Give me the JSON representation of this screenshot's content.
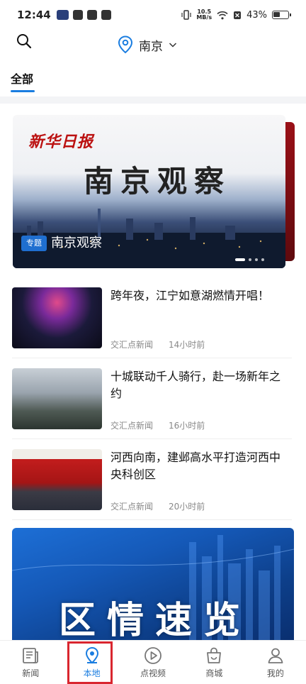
{
  "status_bar": {
    "time": "12:44",
    "net_speed_value": "10.5",
    "net_speed_unit": "MB/s",
    "battery": "43%"
  },
  "header": {
    "city": "南京"
  },
  "tabs": {
    "all": "全部"
  },
  "banner": {
    "logo_text": "新华日报",
    "big_title": "南京观察",
    "tag": "专题",
    "caption": "南京观察"
  },
  "news": [
    {
      "title": "跨年夜，江宁如意湖燃情开唱！",
      "source": "交汇点新闻",
      "time": "14小时前"
    },
    {
      "title": "十城联动千人骑行，赴一场新年之约",
      "source": "交汇点新闻",
      "time": "16小时前"
    },
    {
      "title": "河西向南，建邺高水平打造河西中央科创区",
      "source": "交汇点新闻",
      "time": "20小时前"
    }
  ],
  "banner2": {
    "title": "区情速览"
  },
  "bottom_nav": [
    {
      "label": "新闻",
      "icon": "newspaper-icon"
    },
    {
      "label": "本地",
      "icon": "location-pin-icon"
    },
    {
      "label": "点视频",
      "icon": "play-circle-icon"
    },
    {
      "label": "商城",
      "icon": "shopping-bag-icon"
    },
    {
      "label": "我的",
      "icon": "user-icon"
    }
  ],
  "colors": {
    "accent": "#1a7de0",
    "highlight_box": "#d9262f"
  }
}
